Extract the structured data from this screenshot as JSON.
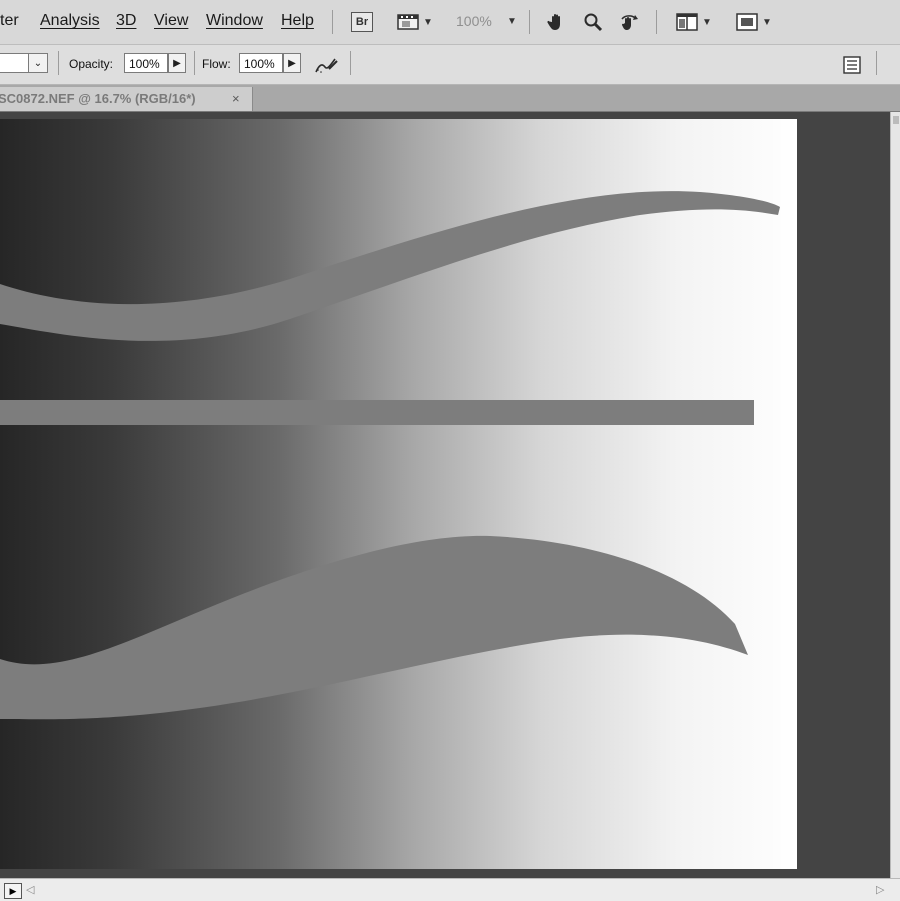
{
  "menubar": {
    "items": [
      {
        "label": "ter"
      },
      {
        "label": "Analysis"
      },
      {
        "label": "3D"
      },
      {
        "label": "View"
      },
      {
        "label": "Window"
      },
      {
        "label": "Help"
      }
    ],
    "bridge_label": "Br",
    "zoom_level": "100%"
  },
  "options": {
    "opacity_label": "Opacity:",
    "opacity_value": "100%",
    "flow_label": "Flow:",
    "flow_value": "100%"
  },
  "document": {
    "tab_title": "SC0872.NEF @ 16.7% (RGB/16*)",
    "close_glyph": "×"
  },
  "colors": {
    "workspace": "#444444",
    "stroke": "#7d7d7d"
  }
}
